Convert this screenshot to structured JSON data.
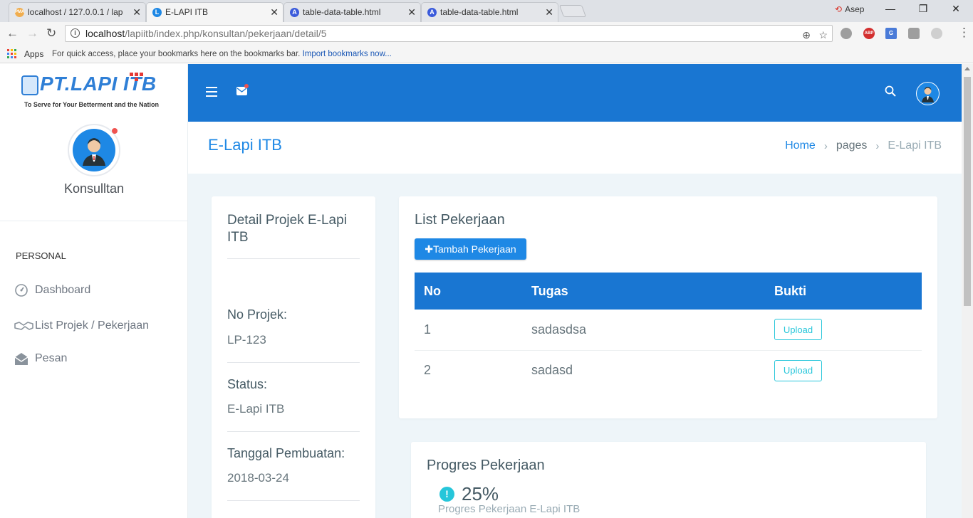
{
  "browser": {
    "tabs": [
      {
        "title": "localhost / 127.0.0.1 / lap",
        "favicon_text": "PMA",
        "favicon_color": "#f0ad4e"
      },
      {
        "title": "E-LAPI ITB",
        "favicon_text": "L",
        "favicon_color": "#1e88e5"
      },
      {
        "title": "table-data-table.html",
        "favicon_text": "A",
        "favicon_color": "#3b5bdb"
      },
      {
        "title": "table-data-table.html",
        "favicon_text": "A",
        "favicon_color": "#3b5bdb"
      }
    ],
    "tab_close": "✕",
    "profile_name": "Asep",
    "window_controls": {
      "minimize": "—",
      "restore": "❐",
      "close": "✕"
    },
    "url_host": "localhost",
    "url_path": "/lapiitb/index.php/konsultan/pekerjaan/detail/5",
    "bookmarks": {
      "apps_label": "Apps",
      "hint": "For quick access, place your bookmarks here on the bookmarks bar.",
      "import_link": "Import bookmarks now..."
    },
    "extensions": [
      {
        "name": "extension-icon",
        "text": "",
        "color": "#9e9e9e"
      },
      {
        "name": "adblock-plus-icon",
        "text": "ABP",
        "color": "#d32f2f"
      },
      {
        "name": "google-translate-icon",
        "text": "G",
        "color": "#4a7bd8"
      },
      {
        "name": "shield-extension-icon",
        "text": "",
        "color": "#9e9e9e"
      },
      {
        "name": "leaf-extension-icon",
        "text": "",
        "color": "#cfcfcf"
      }
    ]
  },
  "sidebar": {
    "logo_text": "PT.LAPI ITB",
    "logo_tagline": "To Serve for Your Betterment and the Nation",
    "user_name": "Konsulltan",
    "section_caption": "PERSONAL",
    "items": [
      {
        "label": "Dashboard",
        "icon": "gauge-icon"
      },
      {
        "label": "List Projek / Pekerjaan",
        "icon": "handshake-icon"
      },
      {
        "label": "Pesan",
        "icon": "envelope-open-icon"
      }
    ]
  },
  "header": {
    "page_title": "E-Lapi ITB",
    "breadcrumb": [
      "Home",
      "pages",
      "E-Lapi ITB"
    ],
    "breadcrumb_separator": "›"
  },
  "detail": {
    "title": "Detail Projek E-Lapi ITB",
    "fields": [
      {
        "label": "No Projek:",
        "value": "LP-123"
      },
      {
        "label": "Status:",
        "value": "E-Lapi ITB"
      },
      {
        "label": "Tanggal Pembuatan:",
        "value": "2018-03-24"
      }
    ]
  },
  "list": {
    "title": "List Pekerjaan",
    "add_button": "Tambah Pekerjaan",
    "columns": [
      "No",
      "Tugas",
      "Bukti"
    ],
    "rows": [
      {
        "no": "1",
        "task": "sadasdsa",
        "action": "Upload"
      },
      {
        "no": "2",
        "task": "sadasd",
        "action": "Upload"
      }
    ]
  },
  "progress": {
    "title": "Progres Pekerjaan",
    "value": "25%",
    "fraction": 0.25,
    "subtitle": "Progres Pekerjaan E-Lapi ITB"
  },
  "colors": {
    "primary": "#1976d2",
    "accent": "#1e88e5",
    "info": "#26c6da",
    "danger": "#ef5350"
  }
}
